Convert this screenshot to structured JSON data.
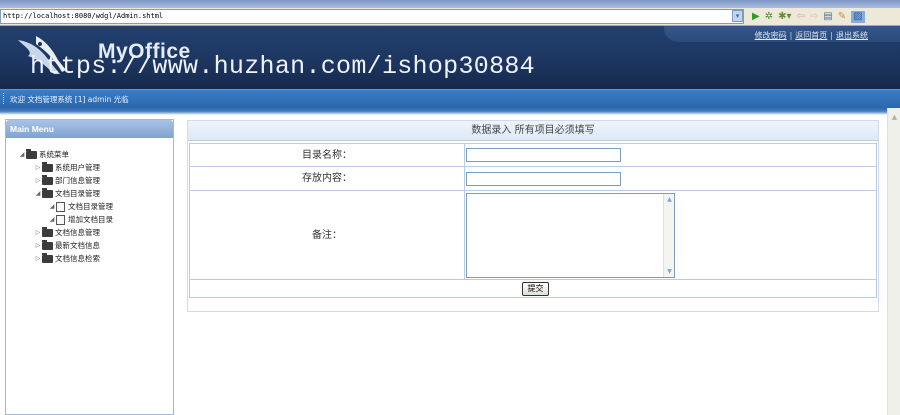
{
  "browser": {
    "url": "http://localhost:8080/wdgl/Admin.shtml",
    "dropdown": "▾"
  },
  "header": {
    "logo_text": "MyOffice",
    "watermark": "https://www.huzhan.com/ishop30884",
    "links": [
      "修改密码",
      "返回首页",
      "退出系统"
    ],
    "link_sep": "|",
    "status_message": "欢迎 文档管理系统 [1] admin 光临"
  },
  "sidebar": {
    "title": "Main Menu",
    "items": [
      {
        "label": "系统菜单"
      },
      {
        "label": "系统用户管理"
      },
      {
        "label": "部门信息管理"
      },
      {
        "label": "文档目录管理"
      },
      {
        "label": "文档目录管理"
      },
      {
        "label": "增加文档目录"
      },
      {
        "label": "文档信息管理"
      },
      {
        "label": "最新文档信息"
      },
      {
        "label": "文档信息检索"
      }
    ]
  },
  "form": {
    "title": "数据录入 所有项目必须填写",
    "fields": [
      {
        "label": "目录名称：",
        "value": ""
      },
      {
        "label": "存放内容：",
        "value": ""
      },
      {
        "label": "备注：",
        "value": ""
      }
    ],
    "submit_label": "提交"
  },
  "colors": {
    "header_bg": "#1c3560",
    "status_bar": "#2c67ad",
    "form_border": "#b8cce3"
  },
  "icons": [
    "go-icon",
    "favorites-icon",
    "back-icon",
    "forward-icon",
    "page-icon",
    "tools-icon"
  ]
}
